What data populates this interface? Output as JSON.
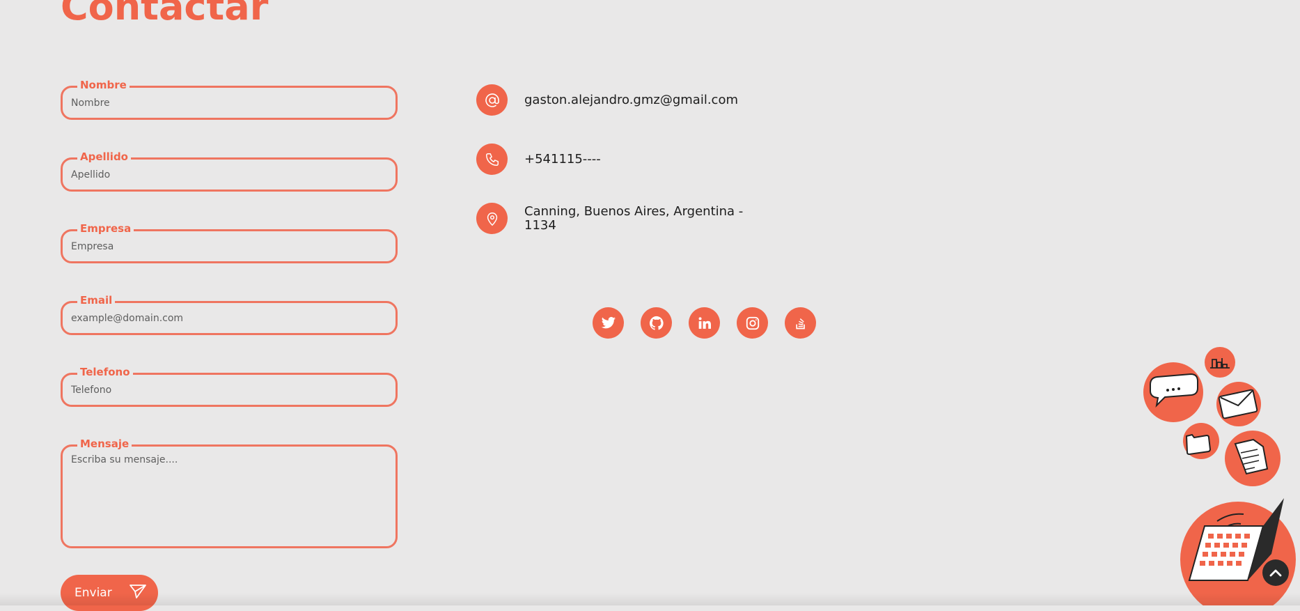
{
  "page": {
    "title": "Contactar"
  },
  "form": {
    "fields": [
      {
        "legend": "Nombre",
        "placeholder": "Nombre"
      },
      {
        "legend": "Apellido",
        "placeholder": "Apellido"
      },
      {
        "legend": "Empresa",
        "placeholder": "Empresa"
      },
      {
        "legend": "Email",
        "placeholder": "example@domain.com"
      },
      {
        "legend": "Telefono",
        "placeholder": "Telefono"
      }
    ],
    "message": {
      "legend": "Mensaje",
      "placeholder": "Escriba su mensaje...."
    },
    "submit_label": "Enviar"
  },
  "contact": {
    "email": "gaston.alejandro.gmz@gmail.com",
    "phone": "+541115----",
    "address": "Canning, Buenos Aires, Argentina - 1134"
  },
  "social": [
    {
      "icon": "twitter-icon"
    },
    {
      "icon": "github-icon"
    },
    {
      "icon": "linkedin-icon"
    },
    {
      "icon": "instagram-icon"
    },
    {
      "icon": "stackoverflow-icon"
    }
  ],
  "colors": {
    "accent": "#f0654a",
    "background": "#e9e8e8",
    "text": "#1d1d1d"
  }
}
